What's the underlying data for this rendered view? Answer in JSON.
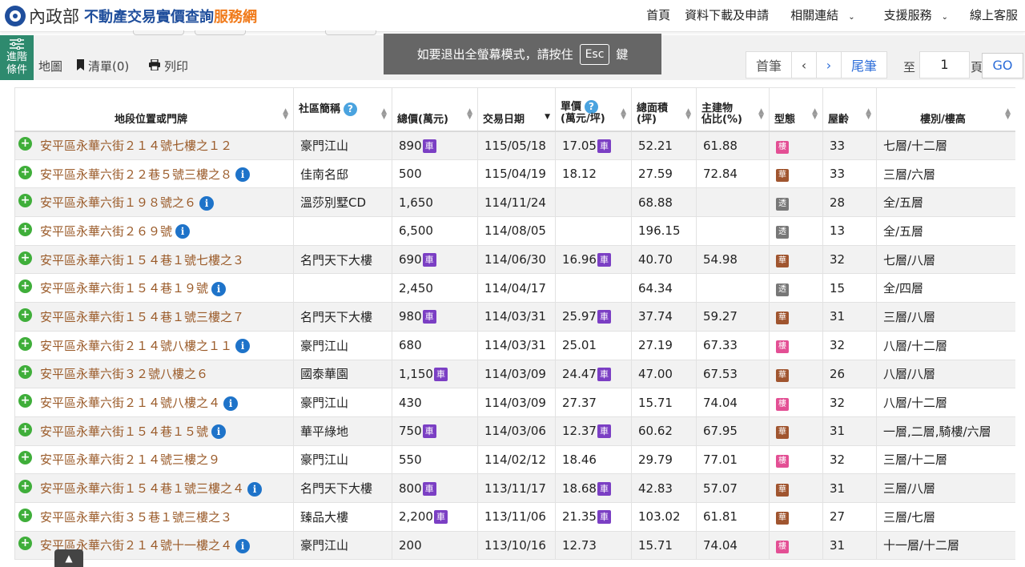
{
  "header": {
    "logo_ministry": "內政部",
    "logo_main": "不動產交易實價查詢",
    "logo_accent": "服務網",
    "nav": [
      {
        "label": "首頁",
        "dropdown": false
      },
      {
        "label": "資料下載及申請",
        "dropdown": false
      },
      {
        "label": "相關連結",
        "dropdown": true
      },
      {
        "label": "支援服務",
        "dropdown": true
      },
      {
        "label": "線上客服",
        "dropdown": false
      }
    ]
  },
  "toolbar": {
    "advanced_label": "進階條件",
    "map_label": "地圖",
    "list_label": "清單(0)",
    "print_label": "列印"
  },
  "fullscreen_toast": {
    "prefix": "如要退出全螢幕模式，請按住",
    "key": "Esc",
    "suffix": "鍵"
  },
  "pagination": {
    "first": "首筆",
    "prev": "‹",
    "next": "›",
    "last": "尾筆",
    "to_label": "至",
    "page_value": "1",
    "page_label": "頁",
    "go": "GO"
  },
  "table": {
    "columns": [
      "地段位置或門牌",
      "社區簡稱",
      "總價(萬元)",
      "交易日期",
      "單價",
      "(萬元/坪)",
      "總面積",
      "(坪)",
      "主建物",
      "佔比(%)",
      "型態",
      "屋齡",
      "樓別/樓高"
    ],
    "badge_car": "車",
    "rows": [
      {
        "addr": "安平區永華六街２１４號七樓之１２",
        "info": false,
        "community": "豪門江山",
        "price": "890",
        "price_car": true,
        "date": "115/05/18",
        "unit": "17.05",
        "unit_car": true,
        "area": "52.21",
        "ratio": "61.88",
        "type": "樓",
        "type_kind": "lou",
        "age": "33",
        "floor": "七層/十二層"
      },
      {
        "addr": "安平區永華六街２２巷５號三樓之８",
        "info": true,
        "community": "佳南名邸",
        "price": "500",
        "price_car": false,
        "date": "115/04/19",
        "unit": "18.12",
        "unit_car": false,
        "area": "27.59",
        "ratio": "72.84",
        "type": "華",
        "type_kind": "hua",
        "age": "33",
        "floor": "三層/六層"
      },
      {
        "addr": "安平區永華六街１９８號之６",
        "info": true,
        "community": "溫莎別墅CD",
        "price": "1,650",
        "price_car": false,
        "date": "114/11/24",
        "unit": "",
        "unit_car": false,
        "area": "68.88",
        "ratio": "",
        "type": "透",
        "type_kind": "tou",
        "age": "28",
        "floor": "全/五層"
      },
      {
        "addr": "安平區永華六街２６９號",
        "info": true,
        "community": "",
        "price": "6,500",
        "price_car": false,
        "date": "114/08/05",
        "unit": "",
        "unit_car": false,
        "area": "196.15",
        "ratio": "",
        "type": "透",
        "type_kind": "tou",
        "age": "13",
        "floor": "全/五層"
      },
      {
        "addr": "安平區永華六街１５４巷１號七樓之３",
        "info": false,
        "community": "名門天下大樓",
        "price": "690",
        "price_car": true,
        "date": "114/06/30",
        "unit": "16.96",
        "unit_car": true,
        "area": "40.70",
        "ratio": "54.98",
        "type": "華",
        "type_kind": "hua",
        "age": "32",
        "floor": "七層/八層"
      },
      {
        "addr": "安平區永華六街１５４巷１９號",
        "info": true,
        "community": "",
        "price": "2,450",
        "price_car": false,
        "date": "114/04/17",
        "unit": "",
        "unit_car": false,
        "area": "64.34",
        "ratio": "",
        "type": "透",
        "type_kind": "tou",
        "age": "15",
        "floor": "全/四層"
      },
      {
        "addr": "安平區永華六街１５４巷１號三樓之７",
        "info": false,
        "community": "名門天下大樓",
        "price": "980",
        "price_car": true,
        "date": "114/03/31",
        "unit": "25.97",
        "unit_car": true,
        "area": "37.74",
        "ratio": "59.27",
        "type": "華",
        "type_kind": "hua",
        "age": "31",
        "floor": "三層/八層"
      },
      {
        "addr": "安平區永華六街２１４號八樓之１１",
        "info": true,
        "community": "豪門江山",
        "price": "680",
        "price_car": false,
        "date": "114/03/31",
        "unit": "25.01",
        "unit_car": false,
        "area": "27.19",
        "ratio": "67.33",
        "type": "樓",
        "type_kind": "lou",
        "age": "32",
        "floor": "八層/十二層"
      },
      {
        "addr": "安平區永華六街３２號八樓之６",
        "info": false,
        "community": "國泰華園",
        "price": "1,150",
        "price_car": true,
        "date": "114/03/09",
        "unit": "24.47",
        "unit_car": true,
        "area": "47.00",
        "ratio": "67.53",
        "type": "華",
        "type_kind": "hua",
        "age": "26",
        "floor": "八層/八層"
      },
      {
        "addr": "安平區永華六街２１４號八樓之４",
        "info": true,
        "community": "豪門江山",
        "price": "430",
        "price_car": false,
        "date": "114/03/09",
        "unit": "27.37",
        "unit_car": false,
        "area": "15.71",
        "ratio": "74.04",
        "type": "樓",
        "type_kind": "lou",
        "age": "32",
        "floor": "八層/十二層"
      },
      {
        "addr": "安平區永華六街１５４巷１５號",
        "info": true,
        "community": "華平綠地",
        "price": "750",
        "price_car": true,
        "date": "114/03/06",
        "unit": "12.37",
        "unit_car": true,
        "area": "60.62",
        "ratio": "67.95",
        "type": "華",
        "type_kind": "hua",
        "age": "31",
        "floor": "一層,二層,騎樓/六層"
      },
      {
        "addr": "安平區永華六街２１４號三樓之９",
        "info": false,
        "community": "豪門江山",
        "price": "550",
        "price_car": false,
        "date": "114/02/12",
        "unit": "18.46",
        "unit_car": false,
        "area": "29.79",
        "ratio": "77.01",
        "type": "樓",
        "type_kind": "lou",
        "age": "32",
        "floor": "三層/十二層"
      },
      {
        "addr": "安平區永華六街１５４巷１號三樓之４",
        "info": true,
        "community": "名門天下大樓",
        "price": "800",
        "price_car": true,
        "date": "113/11/17",
        "unit": "18.68",
        "unit_car": true,
        "area": "42.83",
        "ratio": "57.07",
        "type": "華",
        "type_kind": "hua",
        "age": "31",
        "floor": "三層/八層"
      },
      {
        "addr": "安平區永華六街３５巷１號三樓之３",
        "info": false,
        "community": "臻品大樓",
        "price": "2,200",
        "price_car": true,
        "date": "113/11/06",
        "unit": "21.35",
        "unit_car": true,
        "area": "103.02",
        "ratio": "61.81",
        "type": "華",
        "type_kind": "hua",
        "age": "27",
        "floor": "三層/七層"
      },
      {
        "addr": "安平區永華六街２１４號十一樓之４",
        "info": true,
        "community": "豪門江山",
        "price": "200",
        "price_car": false,
        "date": "113/10/16",
        "unit": "12.73",
        "unit_car": false,
        "area": "15.71",
        "ratio": "74.04",
        "type": "樓",
        "type_kind": "lou",
        "age": "31",
        "floor": "十一層/十二層"
      }
    ]
  }
}
